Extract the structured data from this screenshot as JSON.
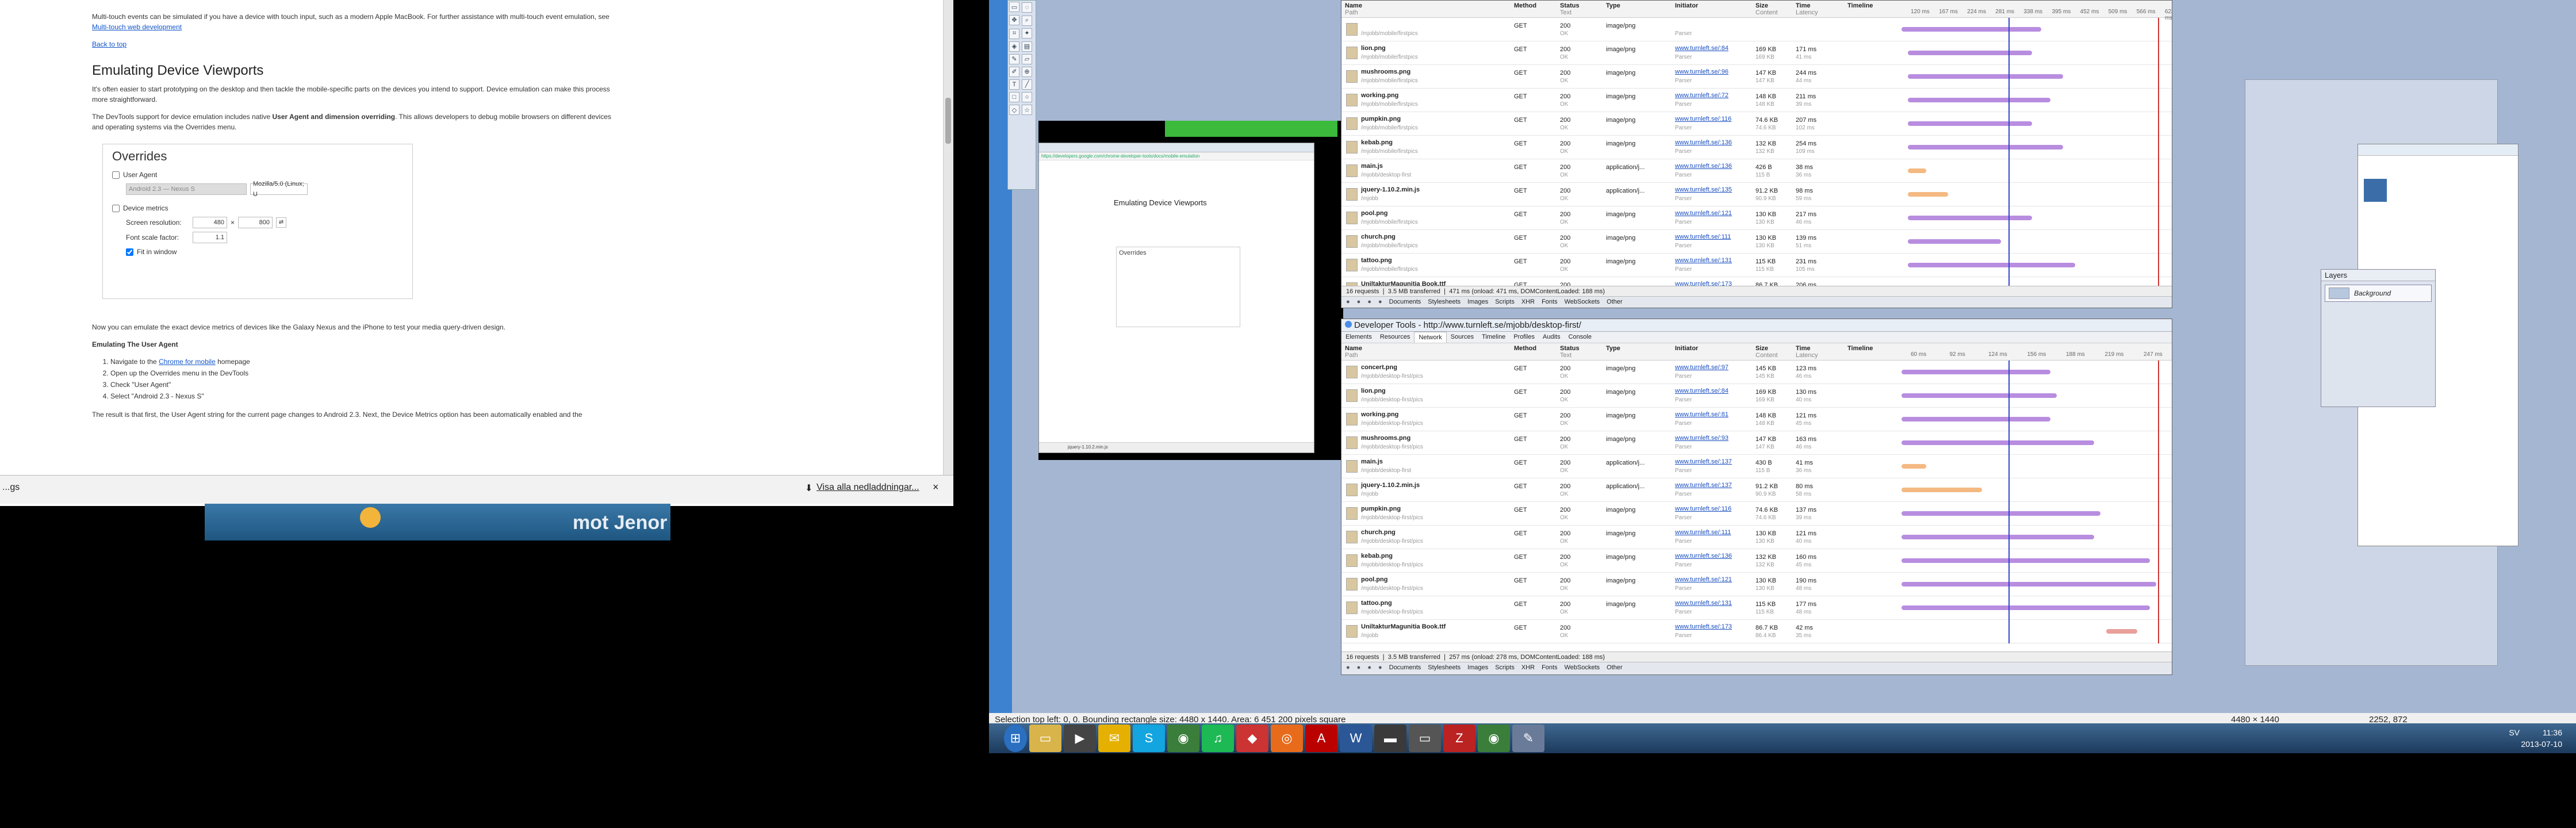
{
  "doc": {
    "p_multitouch": "Multi-touch events can be simulated if you have a device with touch input, such as a modern Apple MacBook. For further assistance with multi-touch event emulation, see",
    "link_multitouch": "Multi-touch web development",
    "back_to_top": "Back to top",
    "h_emulating": "Emulating Device Viewports",
    "p_start": "It's often easier to start prototyping on the desktop and then tackle the mobile-specific parts on the devices you intend to support. Device emulation can make this process more straightforward.",
    "p_devtools_a": "The DevTools support for device emulation includes native",
    "p_devtools_b": "User Agent and dimension overriding",
    "p_devtools_c": ". This allows developers to debug mobile browsers on different devices and operating systems via the Overrides menu.",
    "overrides_title": "Overrides",
    "ua_label": "User Agent",
    "ua_select": "Android 2.3 — Nexus S",
    "ua_value": "Mozilla/5.0 (Linux; U",
    "dm_label": "Device metrics",
    "res_label": "Screen resolution:",
    "res_w": "480",
    "res_x": "×",
    "res_h": "800",
    "font_label": "Font scale factor:",
    "font_val": "1.1",
    "fit_label": "Fit in window",
    "p_now": "Now you can emulate the exact device metrics of devices like the Galaxy Nexus and the iPhone to test your media query-driven design.",
    "h_ua": "Emulating The User Agent",
    "steps": [
      "Navigate to the",
      "Open up the Overrides menu in the DevTools",
      "Check \"User Agent\"",
      "Select \"Android 2.3 - Nexus S\""
    ],
    "step1_link": "Chrome for mobile",
    "step1_tail": "homepage",
    "p_result": "The result is that first, the User Agent string for the current page changes to Android 2.3. Next, the Device Metrics option has been automatically enabled and the"
  },
  "download_bar": {
    "left": "...gs",
    "show_all": "Visa alla nedladdningar...",
    "close": "×"
  },
  "banner": {
    "text": "mot Jenor"
  },
  "devtools_top": {
    "headers": [
      "Name\nPath",
      "Method",
      "Status\nText",
      "Type",
      "Initiator",
      "Size\nContent",
      "Time\nLatency",
      "Timeline"
    ],
    "ticks": [
      "120 ms",
      "167 ms",
      "224 ms",
      "281 ms",
      "338 ms",
      "395 ms",
      "452 ms",
      "509 ms",
      "566 ms",
      "623 ms",
      "680 ms"
    ],
    "rows": [
      {
        "name": "",
        "path": "/mjobb/mobile/firstpics",
        "method": "GET",
        "status": "200",
        "text": "OK",
        "type": "image/png",
        "init": "",
        "init2": "Parser",
        "size": "",
        "content": "",
        "time": "",
        "lat": "",
        "bar": [
          0.1,
          0.55
        ],
        "color": "#b88de0"
      },
      {
        "name": "lion.png",
        "path": "/mjobb/mobile/firstpics",
        "method": "GET",
        "status": "200",
        "text": "OK",
        "type": "image/png",
        "init": "www.turnleft.se/:84",
        "init2": "Parser",
        "size": "169 KB",
        "content": "169 KB",
        "time": "171 ms",
        "lat": "41 ms",
        "bar": [
          0.12,
          0.52
        ],
        "color": "#b88de0"
      },
      {
        "name": "mushrooms.png",
        "path": "/mjobb/mobile/firstpics",
        "method": "GET",
        "status": "200",
        "text": "OK",
        "type": "image/png",
        "init": "www.turnleft.se/:96",
        "init2": "Parser",
        "size": "147 KB",
        "content": "147 KB",
        "time": "244 ms",
        "lat": "44 ms",
        "bar": [
          0.12,
          0.62
        ],
        "color": "#b88de0"
      },
      {
        "name": "working.png",
        "path": "/mjobb/mobile/firstpics",
        "method": "GET",
        "status": "200",
        "text": "OK",
        "type": "image/png",
        "init": "www.turnleft.se/:72",
        "init2": "Parser",
        "size": "148 KB",
        "content": "148 KB",
        "time": "211 ms",
        "lat": "39 ms",
        "bar": [
          0.12,
          0.58
        ],
        "color": "#b88de0"
      },
      {
        "name": "pumpkin.png",
        "path": "/mjobb/mobile/firstpics",
        "method": "GET",
        "status": "200",
        "text": "OK",
        "type": "image/png",
        "init": "www.turnleft.se/:116",
        "init2": "Parser",
        "size": "74.6 KB",
        "content": "74.6 KB",
        "time": "207 ms",
        "lat": "102 ms",
        "bar": [
          0.12,
          0.52
        ],
        "color": "#b88de0"
      },
      {
        "name": "kebab.png",
        "path": "/mjobb/mobile/firstpics",
        "method": "GET",
        "status": "200",
        "text": "OK",
        "type": "image/png",
        "init": "www.turnleft.se/:136",
        "init2": "Parser",
        "size": "132 KB",
        "content": "132 KB",
        "time": "254 ms",
        "lat": "109 ms",
        "bar": [
          0.12,
          0.62
        ],
        "color": "#b88de0"
      },
      {
        "name": "main.js",
        "path": "/mjobb/desktop-first",
        "method": "GET",
        "status": "200",
        "text": "OK",
        "type": "application/j...",
        "init": "www.turnleft.se/:136",
        "init2": "Parser",
        "size": "426 B",
        "content": "115 B",
        "time": "38 ms",
        "lat": "36 ms",
        "bar": [
          0.12,
          0.18
        ],
        "color": "#f4b982"
      },
      {
        "name": "jquery-1.10.2.min.js",
        "path": "/mjobb",
        "method": "GET",
        "status": "200",
        "text": "OK",
        "type": "application/j...",
        "init": "www.turnleft.se/:135",
        "init2": "Parser",
        "size": "91.2 KB",
        "content": "90.9 KB",
        "time": "98 ms",
        "lat": "59 ms",
        "bar": [
          0.12,
          0.25
        ],
        "color": "#f4b982"
      },
      {
        "name": "pool.png",
        "path": "/mjobb/mobile/firstpics",
        "method": "GET",
        "status": "200",
        "text": "OK",
        "type": "image/png",
        "init": "www.turnleft.se/:121",
        "init2": "Parser",
        "size": "130 KB",
        "content": "130 KB",
        "time": "217 ms",
        "lat": "46 ms",
        "bar": [
          0.12,
          0.52
        ],
        "color": "#b88de0"
      },
      {
        "name": "church.png",
        "path": "/mjobb/mobile/firstpics",
        "method": "GET",
        "status": "200",
        "text": "OK",
        "type": "image/png",
        "init": "www.turnleft.se/:111",
        "init2": "Parser",
        "size": "130 KB",
        "content": "130 KB",
        "time": "139 ms",
        "lat": "51 ms",
        "bar": [
          0.12,
          0.42
        ],
        "color": "#b88de0"
      },
      {
        "name": "tattoo.png",
        "path": "/mjobb/mobile/firstpics",
        "method": "GET",
        "status": "200",
        "text": "OK",
        "type": "image/png",
        "init": "www.turnleft.se/:131",
        "init2": "Parser",
        "size": "115 KB",
        "content": "115 KB",
        "time": "231 ms",
        "lat": "105 ms",
        "bar": [
          0.12,
          0.66
        ],
        "color": "#b88de0"
      },
      {
        "name": "UniltakturMagunitia Book.ttf",
        "path": "/mjobb",
        "method": "GET",
        "status": "200",
        "text": "OK",
        "type": "",
        "init": "www.turnleft.se/:173",
        "init2": "Parser",
        "size": "86.7 KB",
        "content": "86.4 KB",
        "time": "206 ms",
        "lat": "45 ms",
        "bar": [
          0.12,
          0.96
        ],
        "color": "#e9a09a"
      }
    ],
    "status": "16 requests  ❘  3.5 MB transferred  ❘  471 ms (onload: 471 ms, DOMContentLoaded: 188 ms)",
    "toolbar": [
      "Documents",
      "Stylesheets",
      "Images",
      "Scripts",
      "XHR",
      "Fonts",
      "WebSockets",
      "Other"
    ]
  },
  "devtools_bottom": {
    "title": "Developer Tools - http://www.turnleft.se/mjobb/desktop-first/",
    "tabs": [
      "Elements",
      "Resources",
      "Network",
      "Sources",
      "Timeline",
      "Profiles",
      "Audits",
      "Console"
    ],
    "active_tab": "Network",
    "headers": [
      "Name\nPath",
      "Method",
      "Status\nText",
      "Type",
      "Initiator",
      "Size\nContent",
      "Time\nLatency",
      "Timeline"
    ],
    "ticks": [
      "60 ms",
      "92 ms",
      "124 ms",
      "156 ms",
      "188 ms",
      "219 ms",
      "247 ms",
      "279 ms"
    ],
    "rows": [
      {
        "name": "concert.png",
        "path": "/mjobb/desktop-first/pics",
        "method": "GET",
        "status": "200",
        "text": "OK",
        "type": "image/png",
        "init": "www.turnleft.se/:97",
        "init2": "Parser",
        "size": "145 KB",
        "content": "145 KB",
        "time": "123 ms",
        "lat": "46 ms",
        "bar": [
          0.1,
          0.58
        ],
        "color": "#b88de0"
      },
      {
        "name": "lion.png",
        "path": "/mjobb/desktop-first/pics",
        "method": "GET",
        "status": "200",
        "text": "OK",
        "type": "image/png",
        "init": "www.turnleft.se/:84",
        "init2": "Parser",
        "size": "169 KB",
        "content": "169 KB",
        "time": "130 ms",
        "lat": "40 ms",
        "bar": [
          0.1,
          0.6
        ],
        "color": "#b88de0"
      },
      {
        "name": "working.png",
        "path": "/mjobb/desktop-first/pics",
        "method": "GET",
        "status": "200",
        "text": "OK",
        "type": "image/png",
        "init": "www.turnleft.se/:81",
        "init2": "Parser",
        "size": "148 KB",
        "content": "148 KB",
        "time": "121 ms",
        "lat": "45 ms",
        "bar": [
          0.1,
          0.58
        ],
        "color": "#b88de0"
      },
      {
        "name": "mushrooms.png",
        "path": "/mjobb/desktop-first/pics",
        "method": "GET",
        "status": "200",
        "text": "OK",
        "type": "image/png",
        "init": "www.turnleft.se/:93",
        "init2": "Parser",
        "size": "147 KB",
        "content": "147 KB",
        "time": "163 ms",
        "lat": "46 ms",
        "bar": [
          0.1,
          0.72
        ],
        "color": "#b88de0"
      },
      {
        "name": "main.js",
        "path": "/mjobb/desktop-first",
        "method": "GET",
        "status": "200",
        "text": "OK",
        "type": "application/j...",
        "init": "www.turnleft.se/:137",
        "init2": "Parser",
        "size": "430 B",
        "content": "115 B",
        "time": "41 ms",
        "lat": "36 ms",
        "bar": [
          0.1,
          0.18
        ],
        "color": "#f4b982"
      },
      {
        "name": "jquery-1.10.2.min.js",
        "path": "/mjobb",
        "method": "GET",
        "status": "200",
        "text": "OK",
        "type": "application/j...",
        "init": "www.turnleft.se/:137",
        "init2": "Parser",
        "size": "91.2 KB",
        "content": "90.9 KB",
        "time": "80 ms",
        "lat": "58 ms",
        "bar": [
          0.1,
          0.36
        ],
        "color": "#f4b982"
      },
      {
        "name": "pumpkin.png",
        "path": "/mjobb/desktop-first/pics",
        "method": "GET",
        "status": "200",
        "text": "OK",
        "type": "image/png",
        "init": "www.turnleft.se/:116",
        "init2": "Parser",
        "size": "74.6 KB",
        "content": "74.6 KB",
        "time": "137 ms",
        "lat": "39 ms",
        "bar": [
          0.1,
          0.74
        ],
        "color": "#b88de0"
      },
      {
        "name": "church.png",
        "path": "/mjobb/desktop-first/pics",
        "method": "GET",
        "status": "200",
        "text": "OK",
        "type": "image/png",
        "init": "www.turnleft.se/:111",
        "init2": "Parser",
        "size": "130 KB",
        "content": "130 KB",
        "time": "121 ms",
        "lat": "40 ms",
        "bar": [
          0.1,
          0.72
        ],
        "color": "#b88de0"
      },
      {
        "name": "kebab.png",
        "path": "/mjobb/desktop-first/pics",
        "method": "GET",
        "status": "200",
        "text": "OK",
        "type": "image/png",
        "init": "www.turnleft.se/:136",
        "init2": "Parser",
        "size": "132 KB",
        "content": "132 KB",
        "time": "160 ms",
        "lat": "45 ms",
        "bar": [
          0.1,
          0.9
        ],
        "color": "#b88de0"
      },
      {
        "name": "pool.png",
        "path": "/mjobb/desktop-first/pics",
        "method": "GET",
        "status": "200",
        "text": "OK",
        "type": "image/png",
        "init": "www.turnleft.se/:121",
        "init2": "Parser",
        "size": "130 KB",
        "content": "130 KB",
        "time": "190 ms",
        "lat": "48 ms",
        "bar": [
          0.1,
          0.92
        ],
        "color": "#b88de0"
      },
      {
        "name": "tattoo.png",
        "path": "/mjobb/desktop-first/pics",
        "method": "GET",
        "status": "200",
        "text": "OK",
        "type": "image/png",
        "init": "www.turnleft.se/:131",
        "init2": "Parser",
        "size": "115 KB",
        "content": "115 KB",
        "time": "177 ms",
        "lat": "48 ms",
        "bar": [
          0.1,
          0.9
        ],
        "color": "#b88de0"
      },
      {
        "name": "UniltakturMagunitia Book.ttf",
        "path": "/mjobb",
        "method": "GET",
        "status": "200",
        "text": "OK",
        "type": "",
        "init": "www.turnleft.se/:173",
        "init2": "Parser",
        "size": "86.7 KB",
        "content": "86.4 KB",
        "time": "42 ms",
        "lat": "35 ms",
        "bar": [
          0.76,
          0.86
        ],
        "color": "#e9a09a"
      }
    ],
    "status": "16 requests  ❘  3.5 MB transferred  ❘  257 ms (onload: 278 ms, DOMContentLoaded: 188 ms)",
    "toolbar": [
      "Documents",
      "Stylesheets",
      "Images",
      "Scripts",
      "XHR",
      "Fonts",
      "WebSockets",
      "Other"
    ]
  },
  "inner_shot": {
    "url": "https://developers.google.com/chrome-developer-tools/docs/mobile-emulation",
    "title": "Emulating Device Viewports",
    "overrides": "Overrides",
    "footer": "jquery-1.10.2.min.js"
  },
  "layers": {
    "title": "Layers",
    "item": "Background"
  },
  "statusbar": {
    "selection": "Selection top left: 0, 0. Bounding rectangle size: 4480 x 1440. Area: 6 451 200 pixels square",
    "size": "4480 × 1440",
    "coords": "2252, 872"
  },
  "clock": {
    "lang": "SV",
    "time": "11:36",
    "date": "2013-07-10"
  }
}
